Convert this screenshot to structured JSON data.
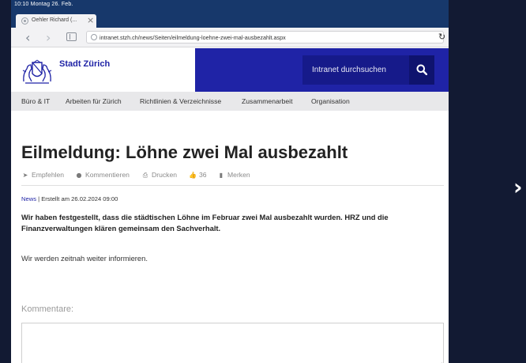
{
  "statusbar": {
    "time": "10:10  Montag 26. Feb."
  },
  "browser": {
    "tab_title": "Oehler Richard (...",
    "tab_close": "×",
    "back": "‹",
    "forward": "›",
    "url": "intranet.stzh.ch/news/Seiten/eilmeldung-loehne-zwei-mal-ausbezahlt.aspx",
    "reload": "↻"
  },
  "header": {
    "brand": "Stadt Zürich",
    "search_placeholder": "Intranet durchsuchen",
    "blue_color": "#1f23a6"
  },
  "nav": {
    "items": [
      "Büro & IT",
      "Arbeiten für Zürich",
      "Richtlinien & Verzeichnisse",
      "Zusammenarbeit",
      "Organisation"
    ]
  },
  "article": {
    "title": "Eilmeldung: Löhne zwei Mal ausbezahlt",
    "actions": {
      "recommend": "Empfehlen",
      "comment": "Kommentieren",
      "print": "Drucken",
      "likes": "36",
      "bookmark": "Merken"
    },
    "category": "News",
    "created": " | Erstellt am 26.02.2024 09:00",
    "lead": "Wir haben festgestellt, dass die städtischen Löhne im Februar zwei Mal ausbezahlt wurden. HRZ und die Finanzverwaltungen klären gemeinsam den Sachverhalt.",
    "body": "Wir werden zeitnah weiter informieren.",
    "comments_label": "Kommentare:"
  },
  "pager": {
    "next": "›"
  }
}
